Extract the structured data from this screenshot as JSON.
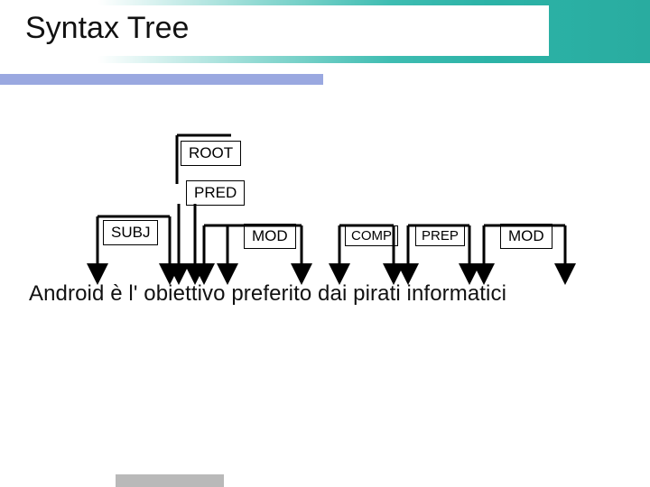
{
  "title": "Syntax Tree",
  "labels": {
    "root": "ROOT",
    "pred": "PRED",
    "subj": "SUBJ",
    "mod1": "MOD",
    "comp": "COMP",
    "prep": "PREP",
    "mod2": "MOD"
  },
  "sentence": "Android è l' obiettivo preferito dai pirati informatici",
  "colors": {
    "accent_teal": "#2cb3a7",
    "underline_blue": "#9aa8e0"
  }
}
